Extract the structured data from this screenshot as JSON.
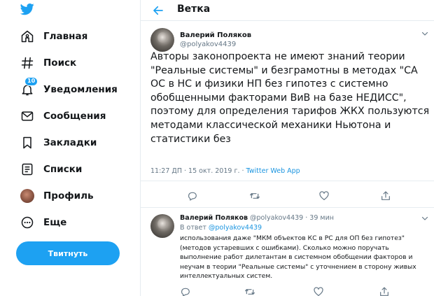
{
  "sidebar": {
    "items": [
      {
        "icon": "home-icon",
        "label": "Главная"
      },
      {
        "icon": "hashtag-icon",
        "label": "Поиск"
      },
      {
        "icon": "bell-icon",
        "label": "Уведомления",
        "badge": "10"
      },
      {
        "icon": "envelope-icon",
        "label": "Сообщения"
      },
      {
        "icon": "bookmark-icon",
        "label": "Закладки"
      },
      {
        "icon": "list-icon",
        "label": "Списки"
      },
      {
        "icon": "avatar",
        "label": "Профиль"
      },
      {
        "icon": "more-icon",
        "label": "Еще"
      }
    ],
    "tweet_button": "Твитнуть"
  },
  "header": {
    "title": "Ветка"
  },
  "main_tweet": {
    "name": "Валерий Поляков",
    "handle": "@polyakov4439",
    "text": "Авторы законопроекта не имеют знаний теории \"Реальные системы\" и безграмотны в методах \"СА ОС в НС и физики НП без гипотез с системно обобщенными факторами ВиВ на базе НЕДИСС\", поэтому для определения тарифов ЖКХ пользуются методами классической механики Ньютона и статистики без",
    "time": "11:27 ДП · 15 окт. 2019 г. · ",
    "source": "Twitter Web App"
  },
  "reply": {
    "name": "Валерий Поляков",
    "handle_time": "@polyakov4439 · 39 мин",
    "reply_to_prefix": "В ответ ",
    "reply_to_handle": "@polyakov4439",
    "text": "использования даже \"МКМ объектов КС в РС для ОП без гипотез\" (методов устаревших с ошибками). Сколько можно поручать выполнение работ дилетантам в системном обобщении факторов и неучам в теории \"Реальные системы\" с уточнением в сторону живых интеллектуальных систем."
  },
  "colors": {
    "accent": "#1da1f2",
    "text": "#14171a",
    "secondary": "#657786",
    "link": "#1b95e0",
    "border": "#e6ecf0"
  }
}
